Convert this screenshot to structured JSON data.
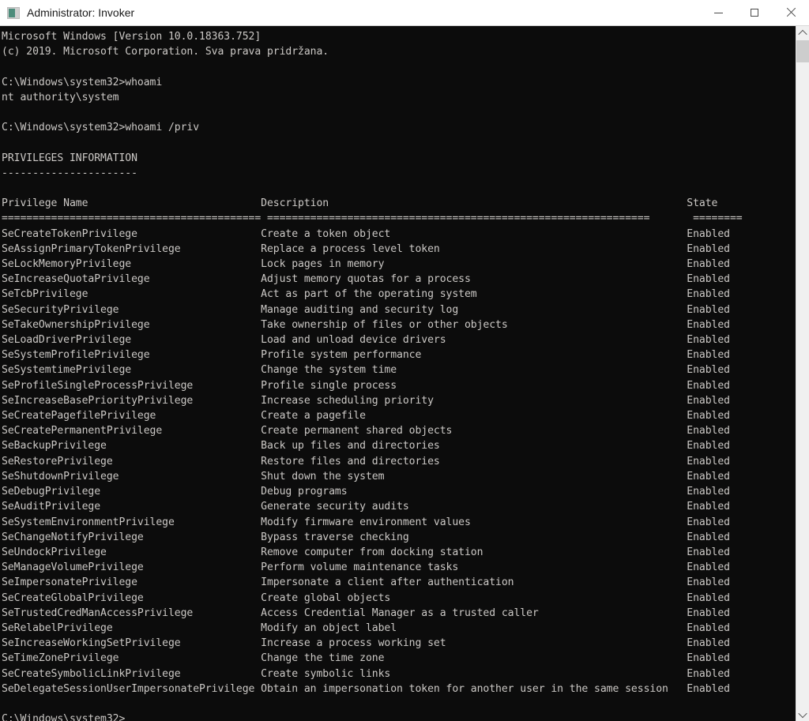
{
  "window": {
    "title": "Administrator: Invoker",
    "icon": "console-icon",
    "background_color": "#0c0c0c",
    "text_color": "#ccc9c6",
    "titlebar_color": "#ffffff"
  },
  "titlebar_buttons": {
    "minimize": "minimize-icon",
    "maximize": "maximize-icon",
    "close": "close-icon"
  },
  "scrollbar": {
    "up_arrow": "chevron-up-icon",
    "down_arrow": "chevron-down-icon",
    "thumb": "scrollbar-thumb"
  },
  "console": {
    "banner": [
      "Microsoft Windows [Version 10.0.18363.752]",
      "(c) 2019. Microsoft Corporation. Sva prava pridržana."
    ],
    "prompt": "C:\\Windows\\system32>",
    "commands": [
      {
        "prompt": "C:\\Windows\\system32>",
        "command": "whoami",
        "output": [
          "nt authority\\system"
        ]
      },
      {
        "prompt": "C:\\Windows\\system32>",
        "command": "whoami /priv",
        "output": []
      }
    ],
    "privileges_header": "PRIVILEGES INFORMATION",
    "privileges_underline": "----------------------",
    "table": {
      "columns": [
        "Privilege Name",
        "Description",
        "State"
      ],
      "column_rules": [
        "==========================================",
        "==============================================================",
        "========"
      ],
      "column_starts": [
        0,
        42,
        111
      ],
      "rows": [
        {
          "name": "SeCreateTokenPrivilege",
          "description": "Create a token object",
          "state": "Enabled"
        },
        {
          "name": "SeAssignPrimaryTokenPrivilege",
          "description": "Replace a process level token",
          "state": "Enabled"
        },
        {
          "name": "SeLockMemoryPrivilege",
          "description": "Lock pages in memory",
          "state": "Enabled"
        },
        {
          "name": "SeIncreaseQuotaPrivilege",
          "description": "Adjust memory quotas for a process",
          "state": "Enabled"
        },
        {
          "name": "SeTcbPrivilege",
          "description": "Act as part of the operating system",
          "state": "Enabled"
        },
        {
          "name": "SeSecurityPrivilege",
          "description": "Manage auditing and security log",
          "state": "Enabled"
        },
        {
          "name": "SeTakeOwnershipPrivilege",
          "description": "Take ownership of files or other objects",
          "state": "Enabled"
        },
        {
          "name": "SeLoadDriverPrivilege",
          "description": "Load and unload device drivers",
          "state": "Enabled"
        },
        {
          "name": "SeSystemProfilePrivilege",
          "description": "Profile system performance",
          "state": "Enabled"
        },
        {
          "name": "SeSystemtimePrivilege",
          "description": "Change the system time",
          "state": "Enabled"
        },
        {
          "name": "SeProfileSingleProcessPrivilege",
          "description": "Profile single process",
          "state": "Enabled"
        },
        {
          "name": "SeIncreaseBasePriorityPrivilege",
          "description": "Increase scheduling priority",
          "state": "Enabled"
        },
        {
          "name": "SeCreatePagefilePrivilege",
          "description": "Create a pagefile",
          "state": "Enabled"
        },
        {
          "name": "SeCreatePermanentPrivilege",
          "description": "Create permanent shared objects",
          "state": "Enabled"
        },
        {
          "name": "SeBackupPrivilege",
          "description": "Back up files and directories",
          "state": "Enabled"
        },
        {
          "name": "SeRestorePrivilege",
          "description": "Restore files and directories",
          "state": "Enabled"
        },
        {
          "name": "SeShutdownPrivilege",
          "description": "Shut down the system",
          "state": "Enabled"
        },
        {
          "name": "SeDebugPrivilege",
          "description": "Debug programs",
          "state": "Enabled"
        },
        {
          "name": "SeAuditPrivilege",
          "description": "Generate security audits",
          "state": "Enabled"
        },
        {
          "name": "SeSystemEnvironmentPrivilege",
          "description": "Modify firmware environment values",
          "state": "Enabled"
        },
        {
          "name": "SeChangeNotifyPrivilege",
          "description": "Bypass traverse checking",
          "state": "Enabled"
        },
        {
          "name": "SeUndockPrivilege",
          "description": "Remove computer from docking station",
          "state": "Enabled"
        },
        {
          "name": "SeManageVolumePrivilege",
          "description": "Perform volume maintenance tasks",
          "state": "Enabled"
        },
        {
          "name": "SeImpersonatePrivilege",
          "description": "Impersonate a client after authentication",
          "state": "Enabled"
        },
        {
          "name": "SeCreateGlobalPrivilege",
          "description": "Create global objects",
          "state": "Enabled"
        },
        {
          "name": "SeTrustedCredManAccessPrivilege",
          "description": "Access Credential Manager as a trusted caller",
          "state": "Enabled"
        },
        {
          "name": "SeRelabelPrivilege",
          "description": "Modify an object label",
          "state": "Enabled"
        },
        {
          "name": "SeIncreaseWorkingSetPrivilege",
          "description": "Increase a process working set",
          "state": "Enabled"
        },
        {
          "name": "SeTimeZonePrivilege",
          "description": "Change the time zone",
          "state": "Enabled"
        },
        {
          "name": "SeCreateSymbolicLinkPrivilege",
          "description": "Create symbolic links",
          "state": "Enabled"
        },
        {
          "name": "SeDelegateSessionUserImpersonatePrivilege",
          "description": "Obtain an impersonation token for another user in the same session",
          "state": "Enabled"
        }
      ]
    }
  }
}
